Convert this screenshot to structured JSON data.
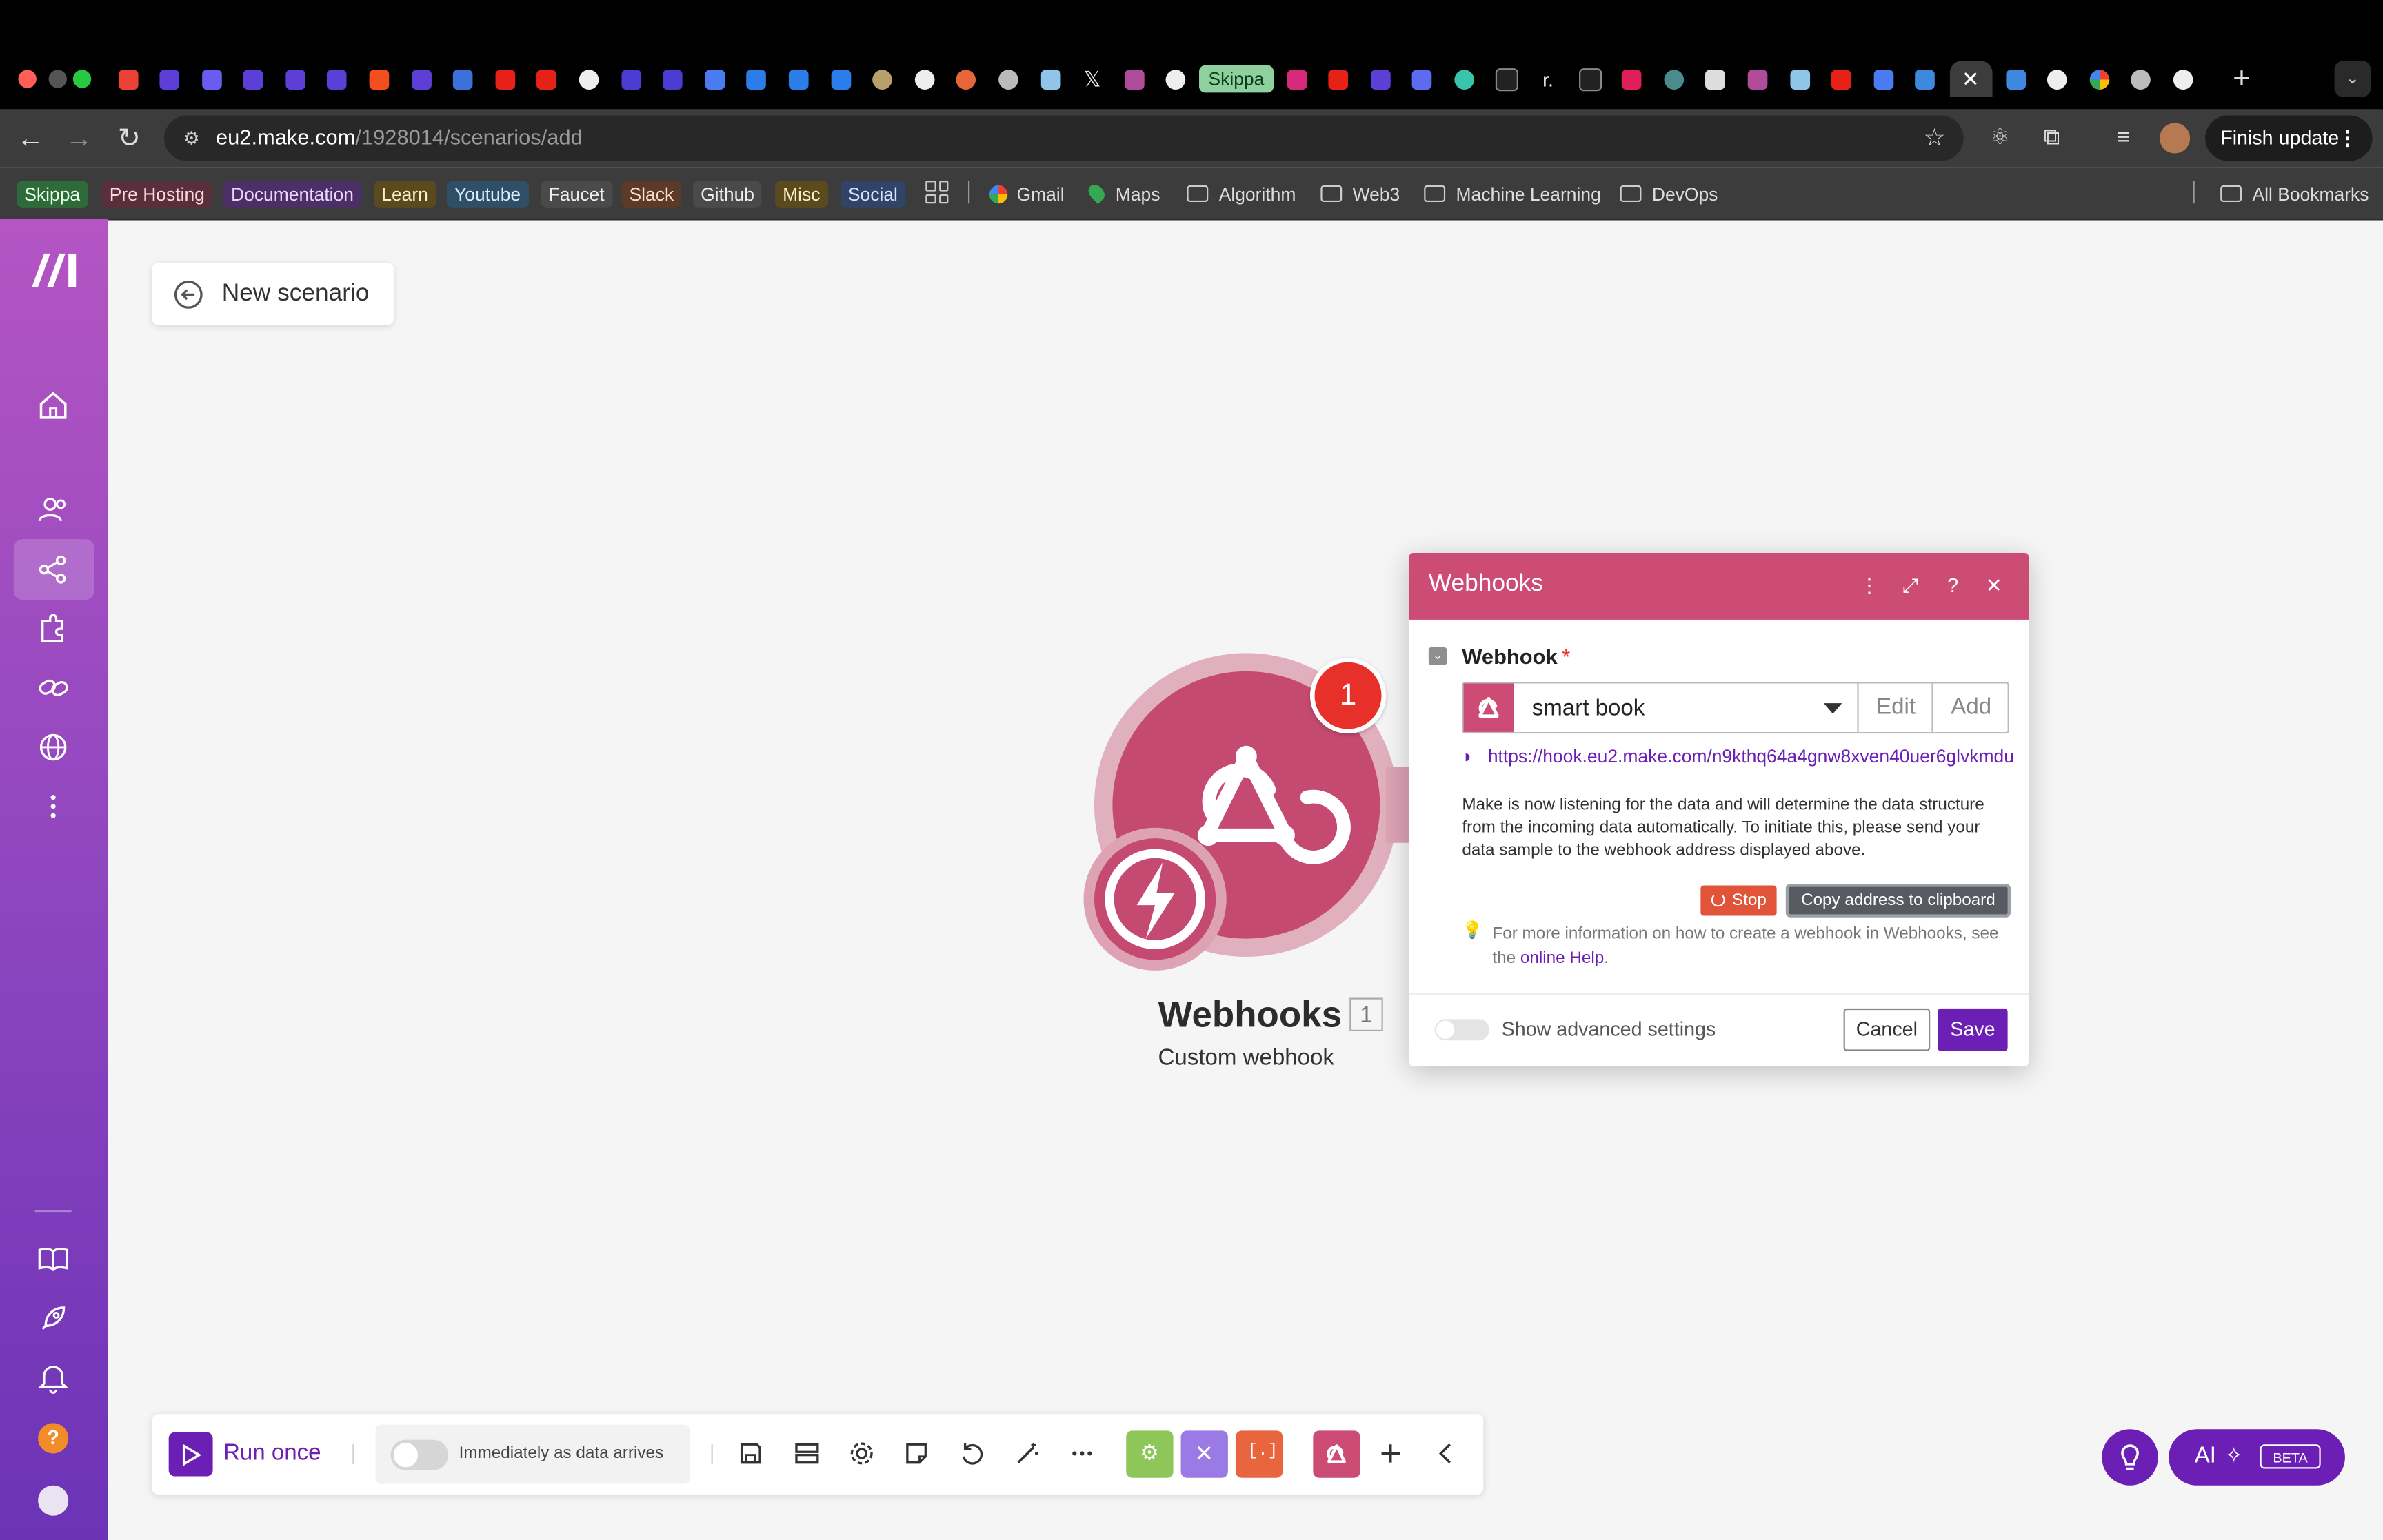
{
  "browser": {
    "url_host": "eu2.make.com",
    "url_path": "/1928014/scenarios/add",
    "finish_update": "Finish update",
    "tab_pill": "Skippa",
    "bookmarks": [
      {
        "label": "Skippa",
        "color": "#2f6b3a",
        "text": "#e8ffe8"
      },
      {
        "label": "Pre Hosting",
        "color": "#5a2f3c",
        "text": "#ffd6e0"
      },
      {
        "label": "Documentation",
        "color": "#4b2f66",
        "text": "#e8d6ff"
      },
      {
        "label": "Learn",
        "color": "#5c4a1f",
        "text": "#ffeec2"
      },
      {
        "label": "Youtube",
        "color": "#2f4f66",
        "text": "#d6ecff"
      },
      {
        "label": "Faucet",
        "color": "#4a4a4a",
        "text": "#eeeeee"
      },
      {
        "label": "Slack",
        "color": "#5c3a2a",
        "text": "#ffdcc8"
      },
      {
        "label": "Github",
        "color": "#4a4a4a",
        "text": "#eeeeee"
      },
      {
        "label": "Misc",
        "color": "#5c4a1f",
        "text": "#ffeec2"
      },
      {
        "label": "Social",
        "color": "#2f4466",
        "text": "#d6e2ff"
      }
    ],
    "bookmark_links": {
      "gmail": "Gmail",
      "maps": "Maps"
    },
    "bookmark_folders": [
      "Algorithm",
      "Web3",
      "Machine Learning",
      "DevOps"
    ],
    "all_bookmarks": "All Bookmarks"
  },
  "canvas": {
    "back_label": "New scenario",
    "module": {
      "title": "Webhooks",
      "number": "1",
      "subtitle": "Custom webhook",
      "badge": "1"
    }
  },
  "dialog": {
    "title": "Webhooks",
    "field_label": "Webhook",
    "required_mark": "*",
    "selected_webhook": "smart book",
    "edit_label": "Edit",
    "add_label": "Add",
    "webhook_url": "https://hook.eu2.make.com/n9kthq64a4gnw8xven40uer6glvkmdu",
    "listening_text": "Make is now listening for the data and will determine the data structure from the incoming data automatically. To initiate this, please send your data sample to the webhook address displayed above.",
    "stop_label": "Stop",
    "copy_label": "Copy address to clipboard",
    "hint_text": "For more information on how to create a webhook in Webhooks, see the",
    "hint_link": "online Help",
    "hint_end": ".",
    "advanced_label": "Show advanced settings",
    "cancel_label": "Cancel",
    "save_label": "Save"
  },
  "bottombar": {
    "run_label": "Run once",
    "schedule_label": "Immediately as data arrives"
  },
  "ai": {
    "label": "AI",
    "beta": "BETA"
  },
  "colors": {
    "brand_purple": "#6c1fb5",
    "webhook_pink": "#cc4c76",
    "badge_red": "#e8302a"
  }
}
